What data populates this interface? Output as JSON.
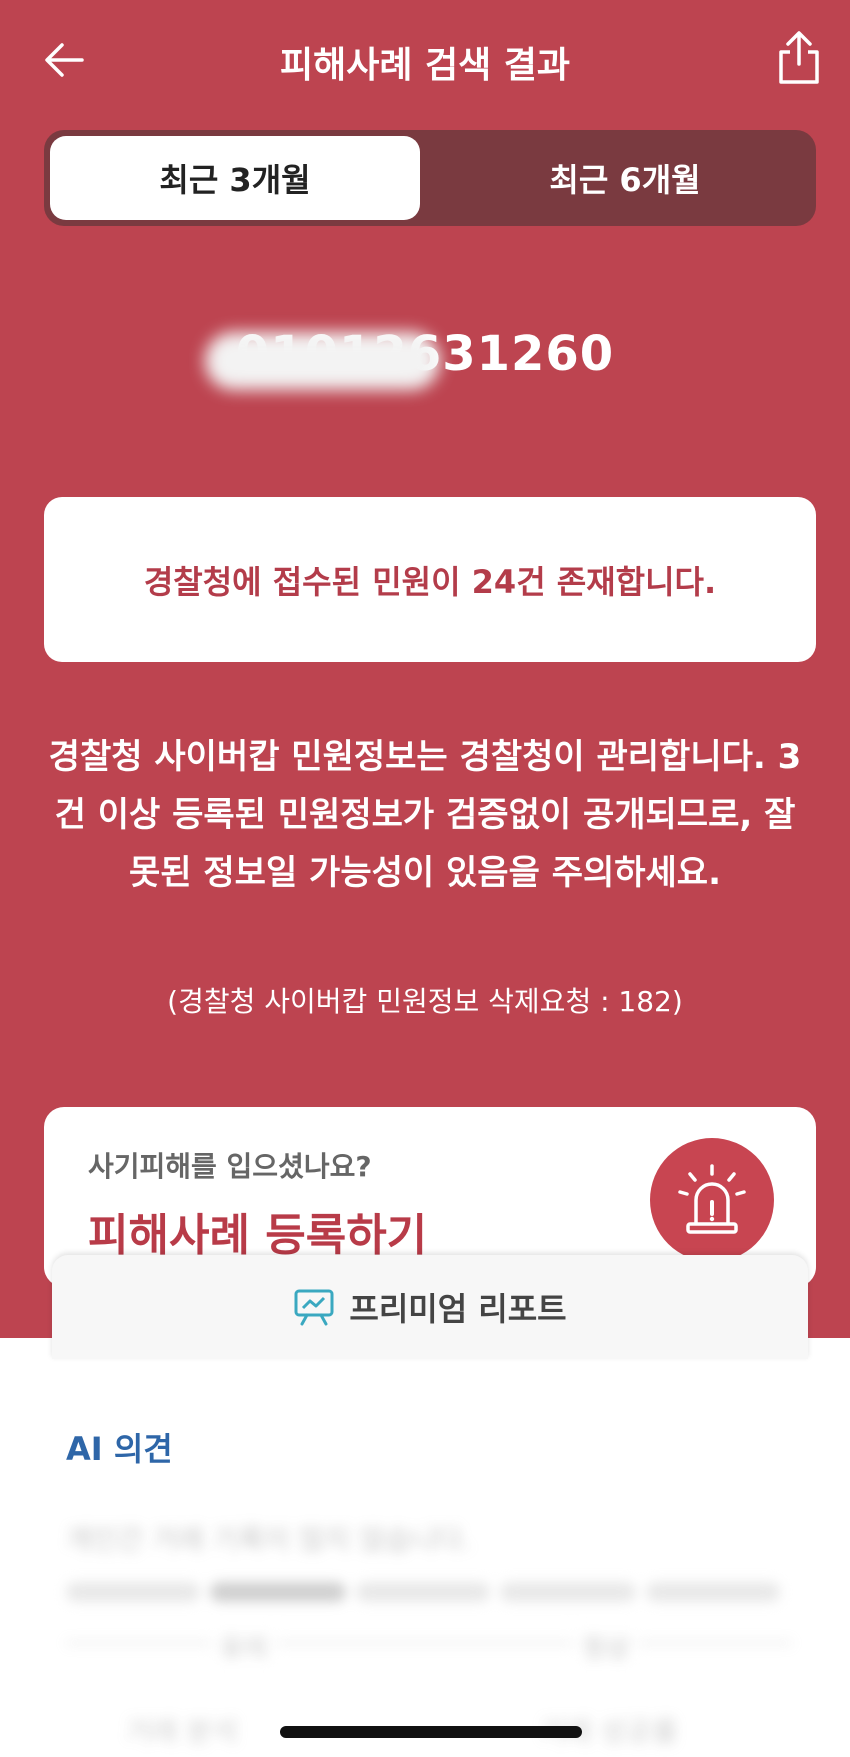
{
  "header": {
    "title": "피해사례 검색 결과"
  },
  "segments": {
    "recent3": "최근 3개월",
    "recent6": "최근 6개월"
  },
  "search": {
    "number": "01012631260"
  },
  "alert": {
    "message": "경찰청에 접수된 민원이 24건 존재합니다."
  },
  "notice": {
    "text": "경찰청 사이버캅 민원정보는 경찰청이 관리합니다. 3건 이상 등록된 민원정보가 검증없이 공개되므로, 잘못된 정보일 가능성이 있음을 주의하세요.",
    "delete_request": "(경찰청 사이버캅 민원정보 삭제요청 : 182)"
  },
  "report": {
    "question": "사기피해를 입으셨나요?",
    "title": "피해사례 등록하기"
  },
  "premium": {
    "label": "프리미엄 리포트"
  },
  "ai": {
    "title": "AI 의견",
    "summary": "개인간 거래 기록이 많지 않습니다.",
    "scale_labels": [
      "유의",
      "정상"
    ],
    "metrics": [
      "거래 분석",
      "거래 성공률"
    ]
  },
  "colors": {
    "brand_red": "#bd4450",
    "accent_blue": "#2e66a8"
  }
}
